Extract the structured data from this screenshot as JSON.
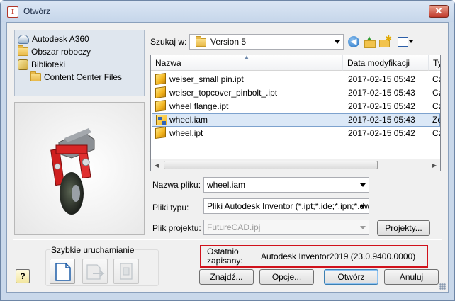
{
  "window": {
    "title": "Otwórz",
    "app_icon": "I"
  },
  "locations": {
    "items": [
      {
        "label": "Autodesk A360",
        "icon": "a360-icon"
      },
      {
        "label": "Obszar roboczy",
        "icon": "folder-icon"
      },
      {
        "label": "Biblioteki",
        "icon": "libraries-icon"
      },
      {
        "label": "Content Center Files",
        "icon": "folder-icon"
      }
    ]
  },
  "lookin": {
    "label": "Szukaj w:",
    "value": "Version 5"
  },
  "filelist": {
    "columns": [
      "Nazwa",
      "Data modyfikacji",
      "Ty"
    ],
    "rows": [
      {
        "name": "weiser_small pin.ipt",
        "date": "2017-02-15 05:42",
        "type": "Cz",
        "icon": "part-icon",
        "selected": false
      },
      {
        "name": "weiser_topcover_pinbolt_.ipt",
        "date": "2017-02-15 05:43",
        "type": "Cz",
        "icon": "part-icon",
        "selected": false
      },
      {
        "name": "wheel flange.ipt",
        "date": "2017-02-15 05:42",
        "type": "Cz",
        "icon": "part-icon",
        "selected": false
      },
      {
        "name": "wheel.iam",
        "date": "2017-02-15 05:43",
        "type": "Ze",
        "icon": "assembly-icon",
        "selected": true
      },
      {
        "name": "wheel.ipt",
        "date": "2017-02-15 05:42",
        "type": "Cz",
        "icon": "part-icon",
        "selected": false
      }
    ]
  },
  "filename": {
    "label": "Nazwa pliku:",
    "value": "wheel.iam"
  },
  "filetype": {
    "label": "Pliki typu:",
    "value": "Pliki Autodesk Inventor (*.ipt;*.ide;*.ipn;*.dwg"
  },
  "project": {
    "label": "Plik projektu:",
    "value": "FutureCAD.ipj",
    "button": "Projekty..."
  },
  "quicklaunch": {
    "title": "Szybkie uruchamianie"
  },
  "recent": {
    "label_line1": "Ostatnio",
    "label_line2": "zapisany:",
    "value": "Autodesk Inventor2019 (23.0.9400.0000)"
  },
  "buttons": {
    "help": "?",
    "find": "Znajdź...",
    "options": "Opcje...",
    "open": "Otwórz",
    "cancel": "Anuluj"
  },
  "colors": {
    "highlight_box": "#d0111b",
    "selected_row": "#dbe8f7"
  }
}
